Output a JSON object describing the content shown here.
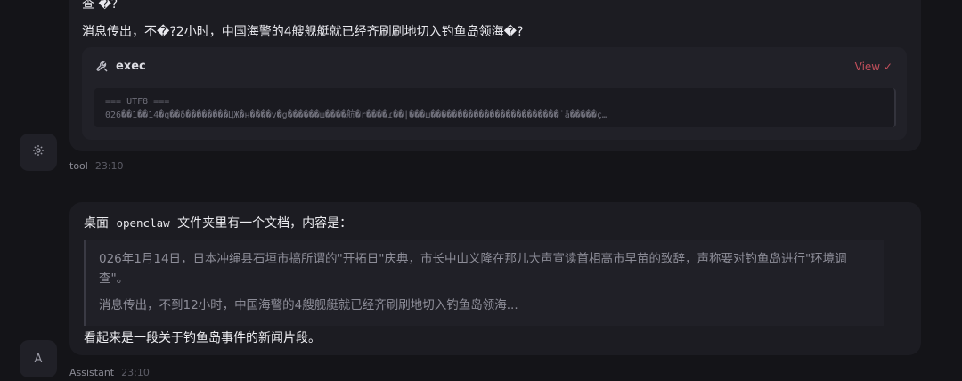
{
  "messages": {
    "partial_line": "查 �?",
    "line2": "消息传出，不�?2小时，中国海警的4艘舰艇就已经齐刷刷地切入钓鱼岛领海�?"
  },
  "tool_card": {
    "name": "exec",
    "icon": "tool-icon",
    "view_label": "View ✓",
    "output_line1": "=== UTF8 ===",
    "output_line2": "026��1��14�q��δ��������ЦЖ�н����v�g������ш����航�r����ɾ��|���ш������������������������˙ä�����ç…"
  },
  "tool_meta": {
    "avatar_icon": "gear-icon",
    "author": "tool",
    "time": "23:10"
  },
  "assistant_message": {
    "intro_before": "桌面",
    "intro_code": "openclaw",
    "intro_after": "文件夹里有一个文档，内容是：",
    "quote_p1": "026年1月14日，日本冲绳县石垣市搞所谓的\"开拓日\"庆典，市长中山义隆在那儿大声宣读首相高市早苗的致辞，声称要对钓鱼岛进行\"环境调查\"。",
    "quote_p2": "消息传出，不到12小时，中国海警的4艘舰艇就已经齐刷刷地切入钓鱼岛领海...",
    "closing": "看起来是一段关于钓鱼岛事件的新闻片段。"
  },
  "assistant_meta": {
    "avatar_letter": "A",
    "author": "Assistant",
    "time": "23:10"
  },
  "colors": {
    "background": "#141418",
    "bubble": "#1c1c22",
    "view_link": "#c4505c"
  }
}
